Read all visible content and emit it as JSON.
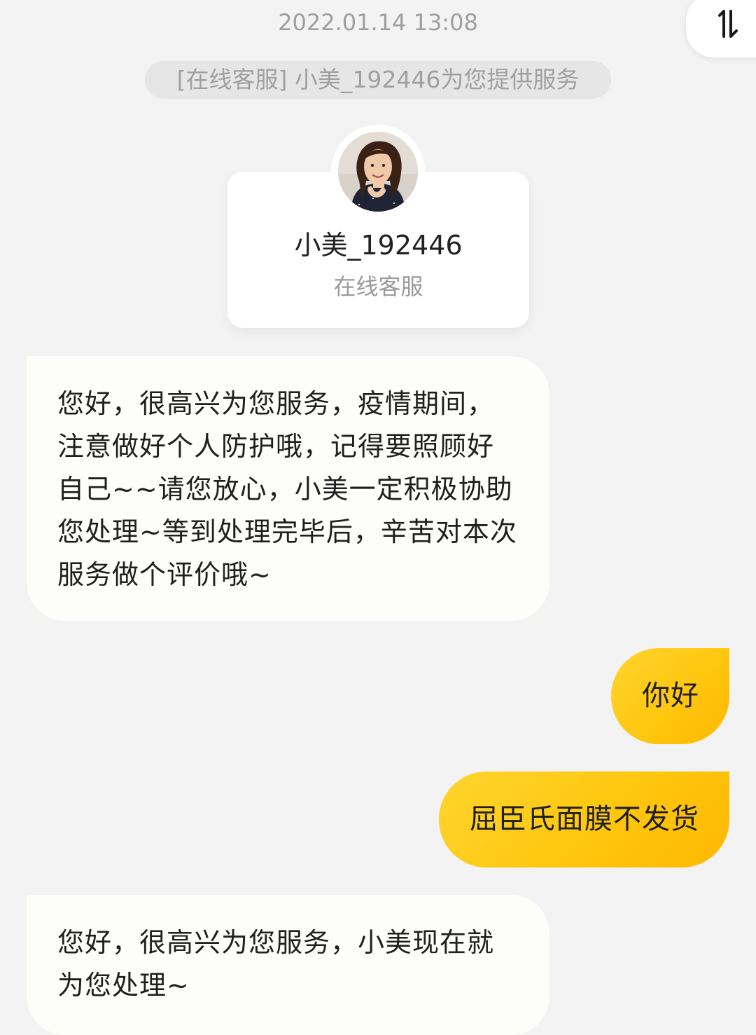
{
  "header": {
    "timestamp": "2022.01.14 13:08",
    "sort_icon": "sort-arrows-icon"
  },
  "notice": {
    "text": "[在线客服] 小美_192446为您提供服务"
  },
  "agent": {
    "name": "小美_192446",
    "role": "在线客服",
    "avatar_icon": "agent-avatar"
  },
  "messages": [
    {
      "sender": "agent",
      "text": "您好，很高兴为您服务，疫情期间，注意做好个人防护哦，记得要照顾好自己~~请您放心，小美一定积极协助您处理~等到处理完毕后，辛苦对本次服务做个评价哦~"
    },
    {
      "sender": "user",
      "text": "你好"
    },
    {
      "sender": "user",
      "text": "屈臣氏面膜不发货"
    },
    {
      "sender": "agent",
      "text": "您好，很高兴为您服务，小美现在就为您处理~"
    }
  ],
  "colors": {
    "background": "#f3f3f3",
    "agent_bubble": "#fdfdfa",
    "user_bubble": "#fec50c",
    "secondary_text": "#9e9e9e"
  }
}
